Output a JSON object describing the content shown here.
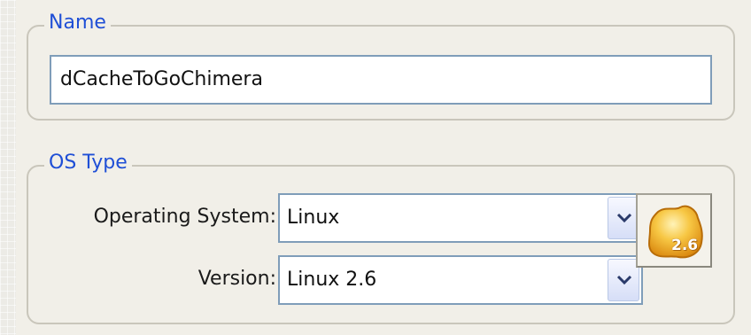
{
  "name_group": {
    "legend": "Name",
    "name_value": "dCacheToGoChimera"
  },
  "os_group": {
    "legend": "OS Type",
    "os_label": "Operating System:",
    "os_value": "Linux",
    "version_label": "Version:",
    "version_value": "Linux 2.6",
    "badge_label": "2.6",
    "badge_icon": "linux-2.6-os-icon"
  },
  "colors": {
    "legend": "#1f4fd6",
    "group_border": "#c9c6bb",
    "field_border": "#7f9db9",
    "badge_gold": "#f0a81c"
  },
  "icons": {
    "dropdown": "chevron-down-icon"
  }
}
